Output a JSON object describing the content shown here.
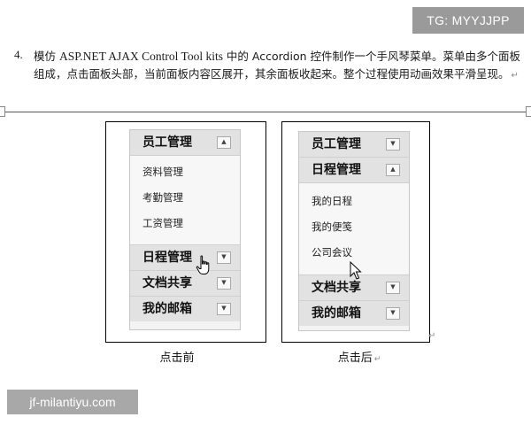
{
  "tag_badge": "TG: MYYJJPP",
  "paragraph": {
    "number": "4.",
    "text_part1": "模仿 ",
    "text_latin": "ASP.NET AJAX Control Tool kits",
    "text_part2": " 中的 Accordion 控件制作一个手风琴菜单。菜单由多个面板组成，点击面板头部，当前面板内容区展开，其余面板收起来。整个过程使用动画效果平滑呈现。",
    "mark": "↵"
  },
  "before": {
    "caption": "点击前",
    "panels": [
      {
        "title": "员工管理",
        "expanded": true,
        "items": [
          "资料管理",
          "考勤管理",
          "工资管理"
        ]
      },
      {
        "title": "日程管理",
        "expanded": false,
        "items": []
      },
      {
        "title": "文档共享",
        "expanded": false,
        "items": []
      },
      {
        "title": "我的邮箱",
        "expanded": false,
        "items": []
      }
    ]
  },
  "after": {
    "caption": "点击后",
    "panels": [
      {
        "title": "员工管理",
        "expanded": false,
        "items": []
      },
      {
        "title": "日程管理",
        "expanded": true,
        "items": [
          "我的日程",
          "我的便笺",
          "公司会议"
        ]
      },
      {
        "title": "文档共享",
        "expanded": false,
        "items": []
      },
      {
        "title": "我的邮箱",
        "expanded": false,
        "items": []
      }
    ]
  },
  "icons": {
    "expanded": "▲",
    "collapsed": "▼",
    "cursor_hand": "hand-pointer-icon",
    "cursor_arrow": "arrow-pointer-icon"
  },
  "watermark": "jf-milantiyu.com",
  "colors": {
    "panel_header": "#e2e2e2",
    "panel_body": "#f7f7f7",
    "badge_bg": "#9a9a9a"
  }
}
